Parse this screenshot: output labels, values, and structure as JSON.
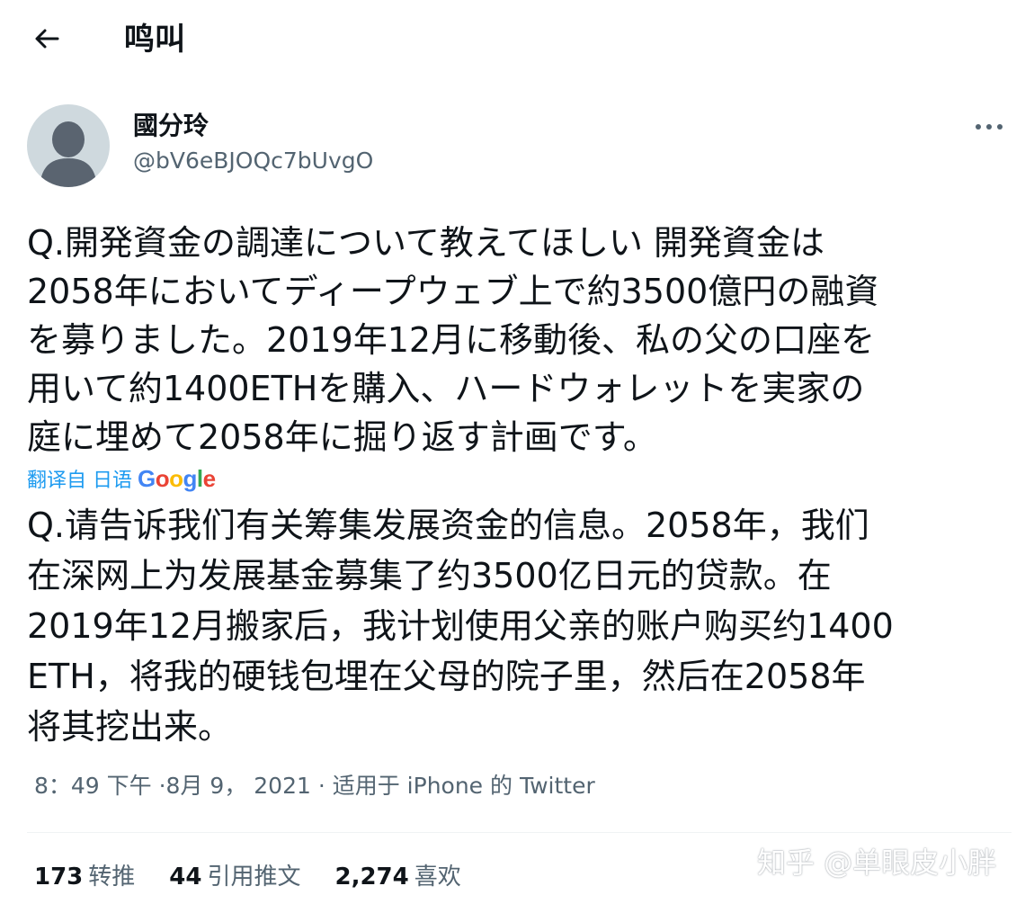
{
  "header": {
    "title": "鸣叫",
    "back_icon": "arrow-left-icon"
  },
  "author": {
    "display_name": "國分玲",
    "handle": "@bV6eBJOQc7bUvgO",
    "avatar_icon": "default-avatar-icon"
  },
  "tweet": {
    "text": "Q.開発資金の調達について教えてほしい 開発資金は\n2058年においてディープウェブ上で約3500億円の融資\nを募りました。2019年12月に移動後、私の父の口座を\n用いて約1400ETHを購入、ハードウォレットを実家の\n庭に埋めて2058年に掘り返す計画です。",
    "translate_label": "翻译自 日语",
    "translate_provider": "Google",
    "translated_text": "Q.请告诉我们有关筹集发展资金的信息。2058年，我们\n在深网上为发展基金募集了约3500亿日元的贷款。在\n2019年12月搬家后，我计划使用父亲的账户购买约1400\nETH，将我的硬钱包埋在父母的院子里，然后在2058年\n将其挖出来。",
    "meta": "8：49 下午 ·8月 9， 2021 · 适用于 iPhone 的 Twitter"
  },
  "stats": [
    {
      "count": "173",
      "label": "转推"
    },
    {
      "count": "44",
      "label": "引用推文"
    },
    {
      "count": "2,274",
      "label": "喜欢"
    }
  ],
  "watermark": "知乎 @单眼皮小胖",
  "colors": {
    "link": "#1d9bf0",
    "secondary": "#536471",
    "text": "#0f1419",
    "avatar_bg": "#cfd9de"
  }
}
